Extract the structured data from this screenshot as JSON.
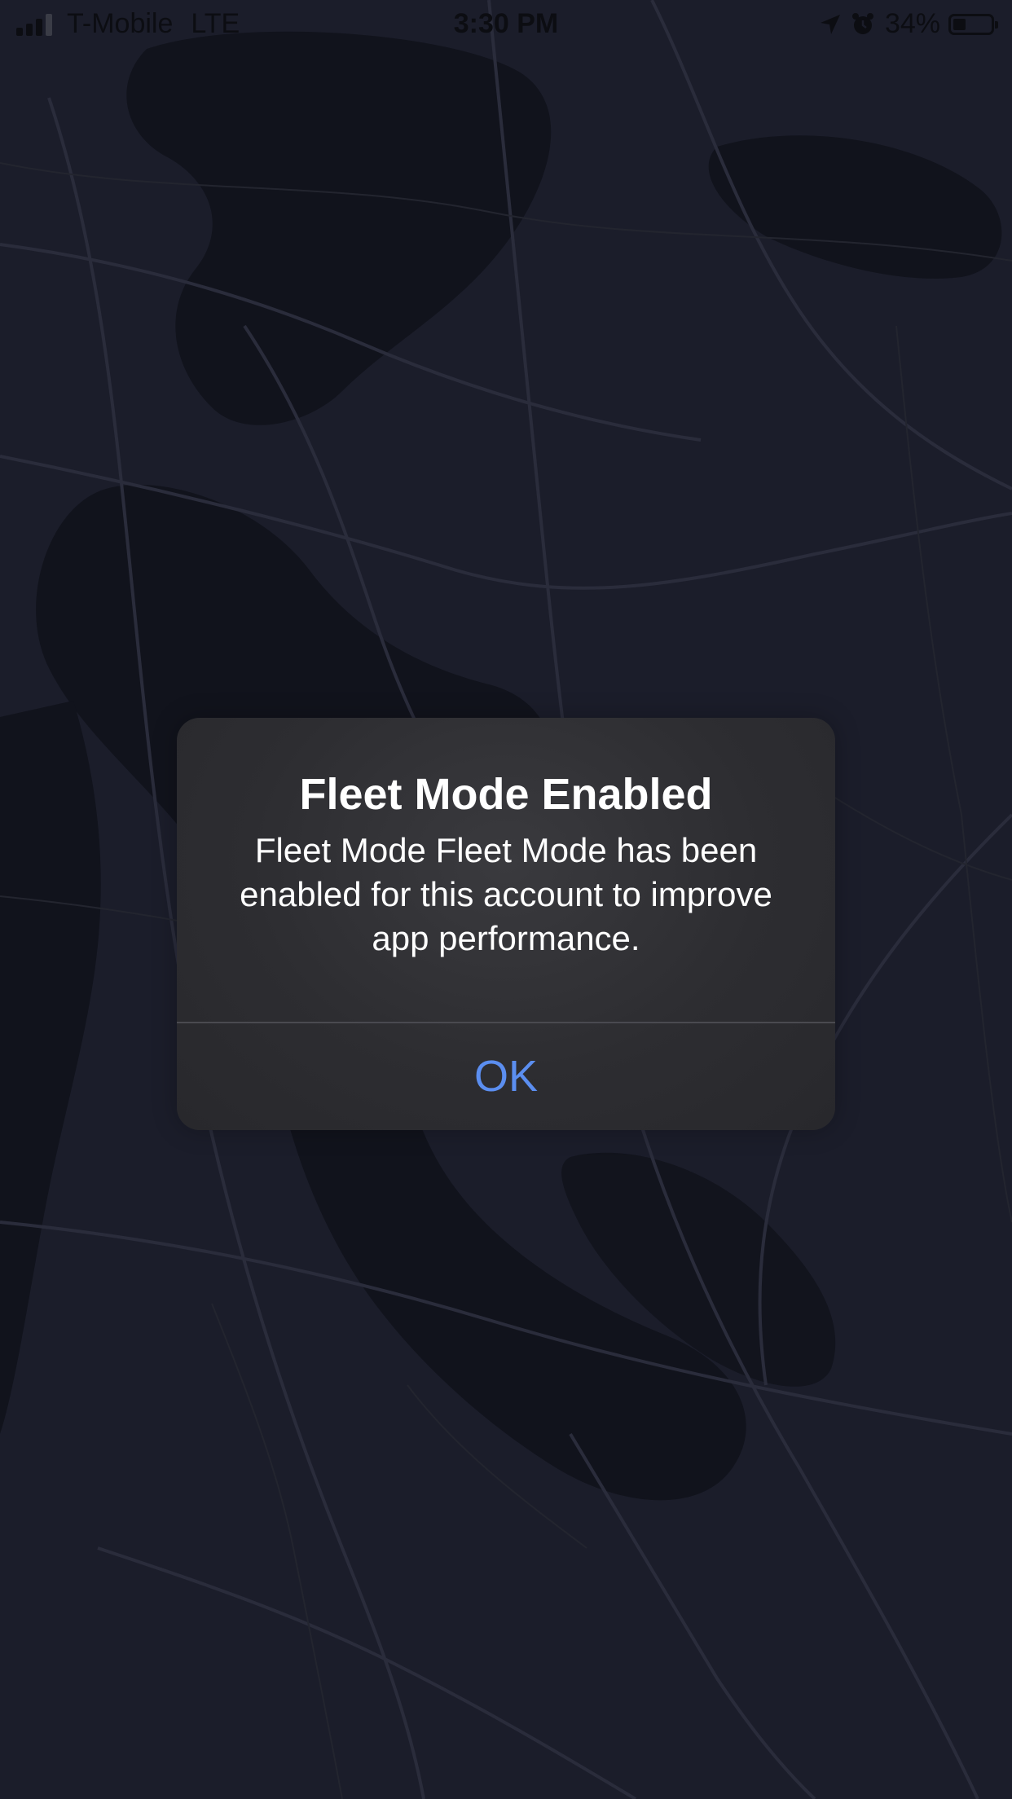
{
  "status_bar": {
    "carrier": "T-Mobile",
    "network": "LTE",
    "time": "3:30 PM",
    "battery_percent_label": "34%",
    "battery_level": 0.34,
    "icons": [
      "signal-icon",
      "location-arrow-icon",
      "alarm-icon",
      "battery-icon"
    ]
  },
  "alert": {
    "title": "Fleet Mode Enabled",
    "message": "Fleet Mode Fleet Mode has been enabled for this account to improve app performance.",
    "ok_label": "OK"
  },
  "colors": {
    "background": "#161824",
    "map_land": "#1b1d2a",
    "map_water": "#11131c",
    "map_roads": "#2a2c3b",
    "alert_background": "#2d2d31",
    "alert_text": "#ffffff",
    "button_text": "#5b8ef0"
  }
}
